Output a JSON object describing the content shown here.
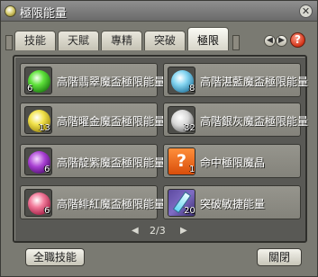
{
  "window": {
    "title": "極限能量",
    "close_label": "✕"
  },
  "tabs": [
    {
      "label": "技能"
    },
    {
      "label": "天賦"
    },
    {
      "label": "專精"
    },
    {
      "label": "突破"
    },
    {
      "label": "極限"
    }
  ],
  "help_label": "?",
  "items": [
    {
      "name": "高階翡翠魔盃極限能量",
      "count": "6",
      "icon": "green-orb-icon"
    },
    {
      "name": "高階湛藍魔盃極限能量",
      "count": "8",
      "icon": "blue-orb-icon"
    },
    {
      "name": "高階曜金魔盃極限能量",
      "count": "13",
      "icon": "gold-orb-icon"
    },
    {
      "name": "高階銀灰魔盃極限能量",
      "count": "32",
      "icon": "grey-orb-icon"
    },
    {
      "name": "高階靛紫魔盃極限能量",
      "count": "6",
      "icon": "purple-orb-icon"
    },
    {
      "name": "命中極限魔晶",
      "count": "1",
      "icon": "question-mark-icon"
    },
    {
      "name": "高階緋紅魔盃極限能量",
      "count": "6",
      "icon": "pink-orb-icon"
    },
    {
      "name": "突破敏捷能量",
      "count": "20",
      "icon": "crystal-icon"
    }
  ],
  "pager": {
    "text": "2/3",
    "prev": "◀",
    "next": "▶"
  },
  "buttons": {
    "all_skills": "全職技能",
    "close": "關閉"
  }
}
